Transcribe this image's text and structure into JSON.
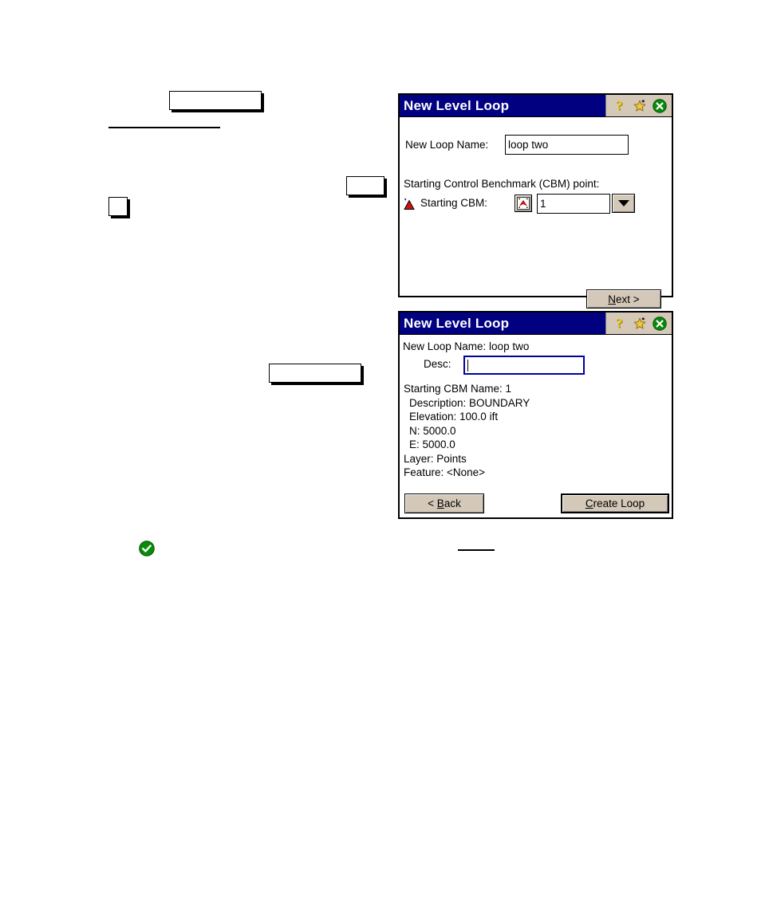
{
  "dialogs": [
    {
      "id": "new-level-loop-step1",
      "title": "New Level Loop",
      "titlebar_icons": [
        "help-icon",
        "favorite-star-icon",
        "close-icon"
      ],
      "fields": {
        "loop_name_label": "New Loop Name:",
        "loop_name_value": "loop two",
        "section_label": "Starting Control Benchmark (CBM) point:",
        "starting_cbm_label": "Starting CBM:",
        "starting_cbm_value": "1",
        "starting_cbm_icon": "cbm-point-pick-icon",
        "dropdown_icon": "chevron-down-icon"
      },
      "buttons": {
        "next": "Next >",
        "next_accel": "N"
      }
    },
    {
      "id": "new-level-loop-step2",
      "title": "New Level Loop",
      "titlebar_icons": [
        "help-icon",
        "favorite-star-icon",
        "close-icon"
      ],
      "fields": {
        "loop_name_readout": "New Loop Name: loop two",
        "desc_label": "Desc:",
        "desc_value": "",
        "desc_focused": true
      },
      "details": [
        {
          "text": "Starting CBM Name: 1",
          "indent": false
        },
        {
          "text": "Description: BOUNDARY",
          "indent": true
        },
        {
          "text": "Elevation: 100.0 ift",
          "indent": true
        },
        {
          "text": "N: 5000.0",
          "indent": true
        },
        {
          "text": "E: 5000.0",
          "indent": true
        },
        {
          "text": "Layer: Points",
          "indent": false
        },
        {
          "text": "Feature: <None>",
          "indent": false
        }
      ],
      "buttons": {
        "back": "< Back",
        "back_accel": "B",
        "create_loop": "Create Loop",
        "create_loop_accel": "C"
      }
    }
  ],
  "annotations": {
    "check_badge": "green-check-icon",
    "placeholder_boxes": 4,
    "rules": 2
  },
  "colors": {
    "titlebar": "#000080",
    "titlebar_text": "#ffffff",
    "button_face": "#d4c8b8",
    "dialog_bg": "#ffffff",
    "focus_border": "#0000a0",
    "accent_green": "#108010",
    "accent_red": "#d00000",
    "accent_gold": "#f0c808"
  }
}
